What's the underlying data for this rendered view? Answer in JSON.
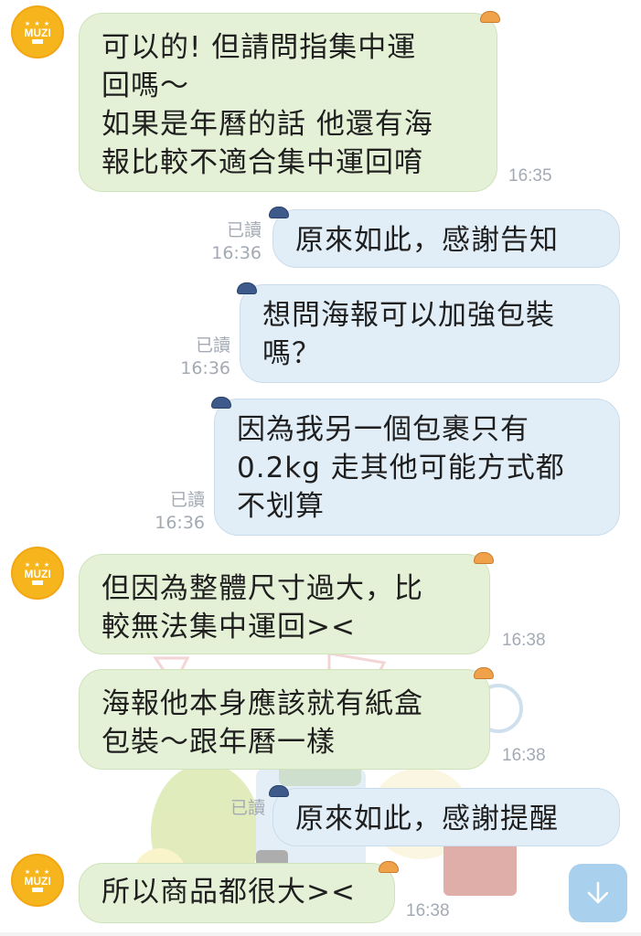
{
  "theme": {
    "incoming_bubble": "#e4f1d6",
    "outgoing_bubble": "#e1eef8",
    "avatar_color": "#f6b51c",
    "scroll_button": "#a9d0ec"
  },
  "contact": {
    "avatar_brand": "MUZI",
    "avatar_stars": "★ ★ ★"
  },
  "messages": [
    {
      "direction": "incoming",
      "lines": [
        "可以的! 但請問指集中運",
        "回嗎～",
        "如果是年曆的話 他還有海",
        "報比較不適合集中運回唷"
      ],
      "time": "16:35"
    },
    {
      "direction": "outgoing",
      "lines": [
        "原來如此，感謝告知"
      ],
      "read": "已讀",
      "time": "16:36"
    },
    {
      "direction": "outgoing",
      "lines": [
        "想問海報可以加強包裝",
        "嗎？"
      ],
      "read": "已讀",
      "time": "16:36"
    },
    {
      "direction": "outgoing",
      "lines": [
        "因為我另一個包裹只有",
        "0.2kg 走其他可能方式都",
        "不划算"
      ],
      "read": "已讀",
      "time": "16:36"
    },
    {
      "direction": "incoming",
      "lines": [
        "但因為整體尺寸過大，比",
        "較無法集中運回><"
      ],
      "time": "16:38"
    },
    {
      "direction": "incoming",
      "lines": [
        "海報他本身應該就有紙盒",
        "包裝～跟年曆一樣"
      ],
      "time": "16:38"
    },
    {
      "direction": "outgoing",
      "lines": [
        "原來如此，感謝提醒"
      ],
      "read": "已讀",
      "time": ""
    },
    {
      "direction": "incoming",
      "lines": [
        "所以商品都很大><"
      ],
      "time": "16:38"
    }
  ],
  "icons": {
    "scroll_down": "arrow-down-icon",
    "hat_incoming": "orange-hat-icon",
    "hat_outgoing": "blue-cap-icon"
  }
}
